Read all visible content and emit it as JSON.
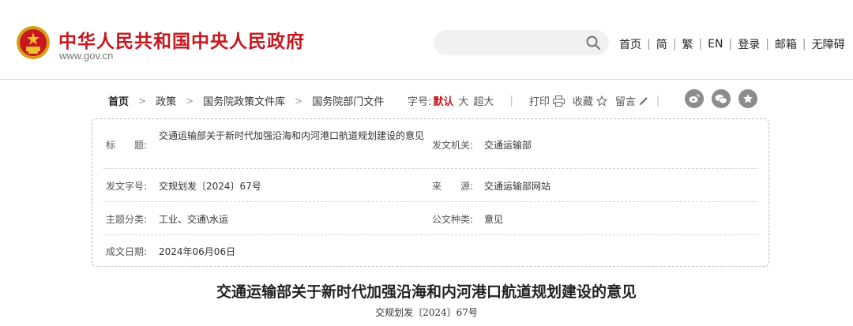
{
  "header": {
    "site_name": "中华人民共和国中央人民政府",
    "site_url": "www.gov.cn",
    "emblem_icon": "national-emblem-icon",
    "brand_color": "#c8171e",
    "search": {
      "placeholder": "",
      "value": "",
      "icon": "search-icon"
    },
    "nav": [
      "首页",
      "简",
      "繁",
      "EN",
      "登录",
      "邮箱",
      "无障碍"
    ]
  },
  "breadcrumb": [
    "首页",
    "政策",
    "国务院政策文件库",
    "国务院部门文件"
  ],
  "toolbar": {
    "font_size_label": "字号:",
    "font_sizes": [
      "默认",
      "大",
      "超大"
    ],
    "print_label": "打印",
    "print_icon": "printer-icon",
    "favorite_label": "收藏",
    "favorite_icon": "star-outline-icon",
    "comment_label": "留言",
    "comment_icon": "pencil-icon",
    "share_icons": [
      "weibo-icon",
      "wechat-icon",
      "qzone-icon"
    ]
  },
  "doc_info": {
    "title_label": "标　　题:",
    "title_value": "交通运输部关于新时代加强沿海和内河港口航道规划建设的意见",
    "issuer_label": "发文机关:",
    "issuer_value": "交通运输部",
    "docno_label": "发文字号:",
    "docno_value": "交规划发〔2024〕67号",
    "source_label": "来　　源:",
    "source_value": "交通运输部网站",
    "topic_label": "主题分类:",
    "topic_value": "工业、交通\\水运",
    "type_label": "公文种类:",
    "type_value": "意见",
    "date_label": "成文日期:",
    "date_value": "2024年06月06日"
  },
  "article": {
    "title": "交通运输部关于新时代加强沿海和内河港口航道规划建设的意见",
    "doc_number": "交规划发〔2024〕67号"
  }
}
